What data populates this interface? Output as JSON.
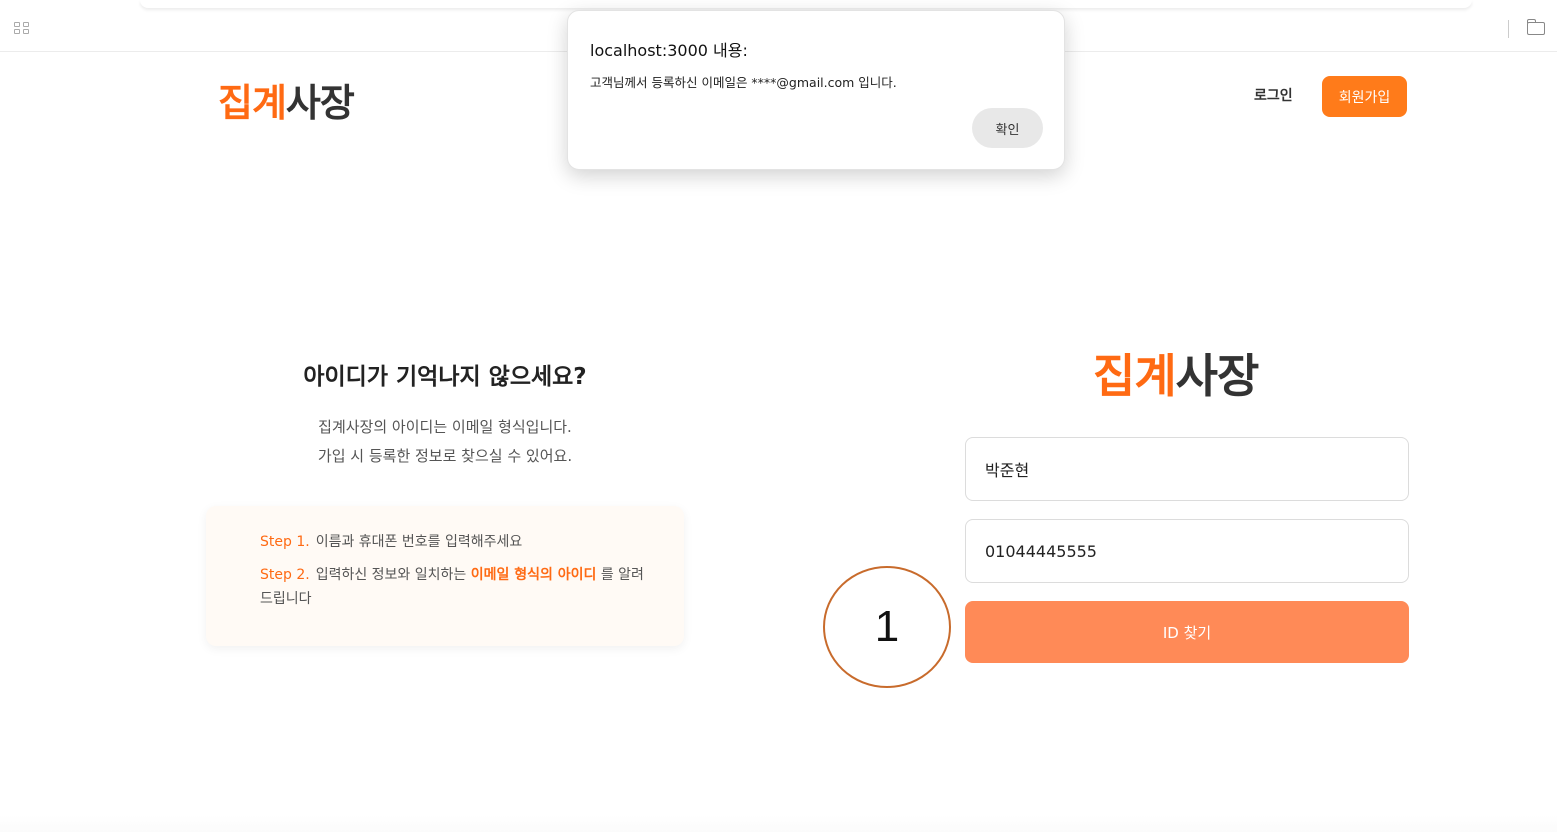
{
  "header": {
    "logo_orange": "집계",
    "logo_dark": "사장",
    "login_label": "로그인",
    "signup_label": "회원가입"
  },
  "find_id": {
    "title": "아이디가 기억나지 않으세요?",
    "desc_line1": "집계사장의 아이디는 이메일 형식입니다.",
    "desc_line2": "가입 시 등록한 정보로 찾으실 수 있어요.",
    "step1_label": "Step 1.",
    "step1_text": "이름과 휴대폰 번호를 입력해주세요",
    "step2_label": "Step 2.",
    "step2_text_before": "입력하신 정보와 일치하는 ",
    "step2_highlight": "이메일 형식의 아이디",
    "step2_text_after": " 를 알려드립니다"
  },
  "form": {
    "logo_orange": "집계",
    "logo_dark": "사장",
    "name_value": "박준현",
    "phone_value": "01044445555",
    "submit_label": "ID 찾기"
  },
  "annotation": {
    "number": "1"
  },
  "dialog": {
    "title": "localhost:3000 내용:",
    "message": "고객님께서 등록하신 이메일은 ****@gmail.com 입니다.",
    "ok_label": "확인"
  },
  "colors": {
    "brand_orange": "#ff6a13",
    "button_orange": "#ff8a57",
    "signup_orange": "#ff7b1a"
  }
}
